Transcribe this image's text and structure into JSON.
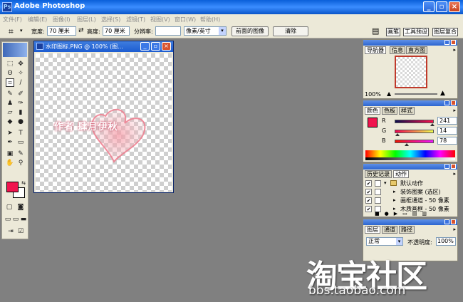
{
  "app": {
    "title": "Adobe Photoshop",
    "icon": "ps-app-icon"
  },
  "menu": [
    "文件(F)",
    "编辑(E)",
    "图像(I)",
    "图层(L)",
    "选择(S)",
    "滤镜(T)",
    "视图(V)",
    "窗口(W)",
    "帮助(H)"
  ],
  "options": {
    "width_label": "宽度:",
    "width_value": "70 厘米",
    "height_label": "高度:",
    "height_value": "70 厘米",
    "resolution_label": "分辨率:",
    "resolution_value": "",
    "unit_value": "像素/英寸",
    "front_image_label": "前面的图像",
    "clear_label": "清除",
    "well_tabs": [
      "画笔",
      "工具预设",
      "图层复合"
    ]
  },
  "document": {
    "title": "水印图标.PNG @ 100% (图...",
    "watermark_text": "作者 肆月伊秋",
    "foreground_color": "#f0144e"
  },
  "navigator": {
    "tabs": [
      "导航器",
      "信息",
      "直方图"
    ],
    "zoom": "100%"
  },
  "color": {
    "tabs": [
      "颜色",
      "色板",
      "样式"
    ],
    "r": {
      "label": "R",
      "value": "241"
    },
    "g": {
      "label": "G",
      "value": "14"
    },
    "b": {
      "label": "B",
      "value": "78"
    }
  },
  "actions": {
    "tabs": [
      "历史记录",
      "动作"
    ],
    "items": [
      "默认动作",
      "装饰图案 (选区)",
      "画框通道 - 50 像素",
      "木质画框 - 50 像素"
    ]
  },
  "layers": {
    "tabs": [
      "图层",
      "通道",
      "路径"
    ],
    "mode": "正常",
    "opacity_label": "不透明度:",
    "opacity_value": "100%"
  },
  "site": {
    "brand": "淘宝社区",
    "url": "bbs.taobao.com"
  }
}
